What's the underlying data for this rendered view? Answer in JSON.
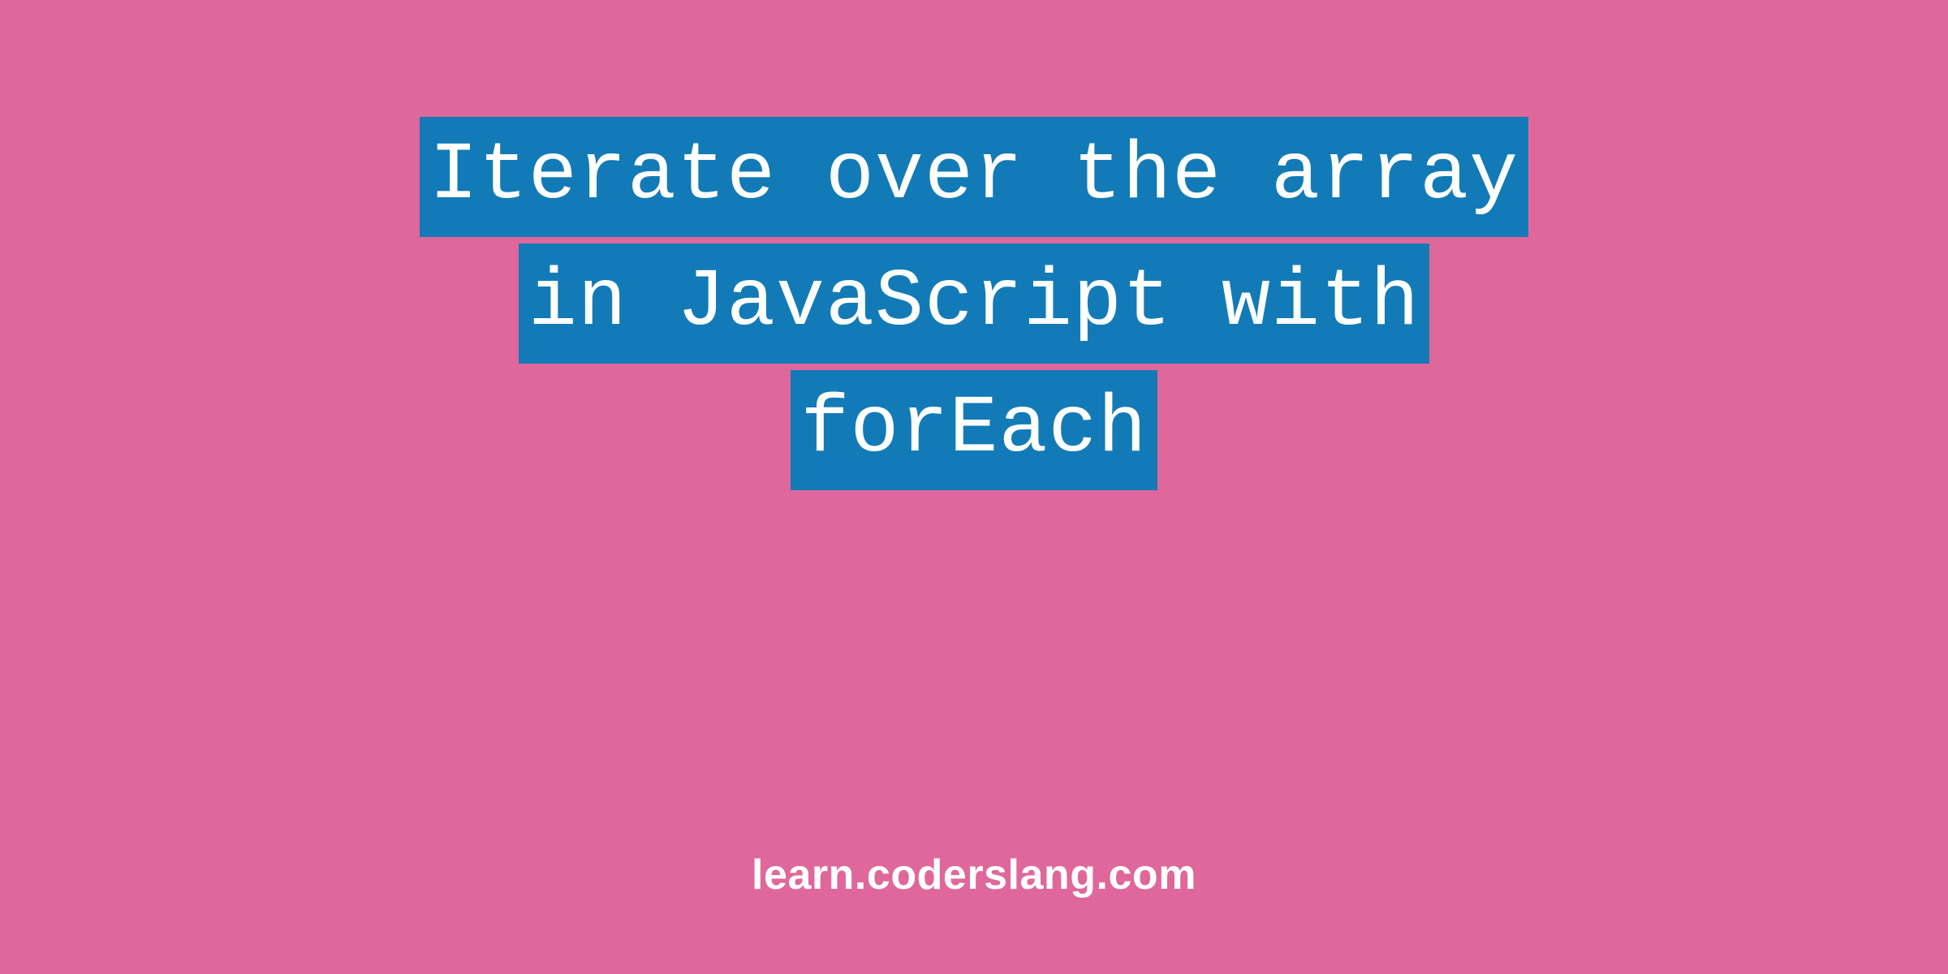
{
  "title": {
    "lines": [
      "Iterate over the array",
      " in JavaScript with ",
      "forEach"
    ]
  },
  "footer": {
    "url": "learn.coderslang.com"
  },
  "colors": {
    "background": "#df679b",
    "highlight": "#127bb7",
    "text_primary": "#ffffff"
  }
}
